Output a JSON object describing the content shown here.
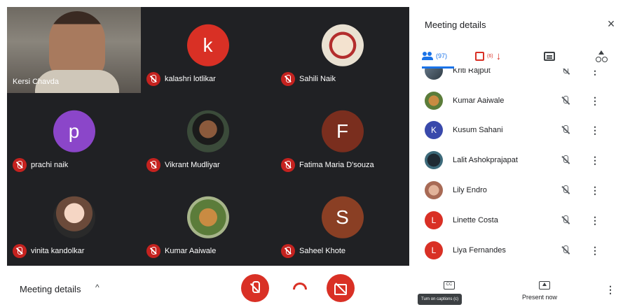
{
  "grid": {
    "tiles": [
      {
        "name": "Kersi Chavda",
        "type": "camera"
      },
      {
        "name": "kalashri lotlikar",
        "initial": "k",
        "color": "#d93025"
      },
      {
        "name": "Sahili Naik",
        "type": "food"
      },
      {
        "name": "prachi naik",
        "initial": "p",
        "color": "#8b46c9"
      },
      {
        "name": "Vikrant Mudliyar",
        "type": "man"
      },
      {
        "name": "Fatima Maria D'souza",
        "initial": "F",
        "color": "#7a2e1e"
      },
      {
        "name": "vinita kandolkar",
        "type": "woman"
      },
      {
        "name": "Kumar Aaiwale",
        "type": "garden"
      },
      {
        "name": "Saheel Khote",
        "initial": "S",
        "color": "#8a3f24"
      }
    ]
  },
  "panel": {
    "title": "Meeting details",
    "close_icon": "×",
    "tabs": {
      "people_count": "(97)",
      "tasks_count": "(6)",
      "download_arrow": "↓"
    },
    "participants": [
      {
        "name": "Kriti Rajput",
        "type": "photo"
      },
      {
        "name": "Kumar Aaiwale",
        "type": "photo"
      },
      {
        "name": "Kusum Sahani",
        "initial": "K",
        "color": "#3949ab"
      },
      {
        "name": "Lalit Ashokprajapat",
        "type": "photo"
      },
      {
        "name": "Lily Endro",
        "type": "photo"
      },
      {
        "name": "Linette Costa",
        "initial": "L",
        "color": "#d93025"
      },
      {
        "name": "Liya Fernandes",
        "initial": "L",
        "color": "#d93025"
      }
    ],
    "more_icon": "⋮"
  },
  "bottombar": {
    "meeting_details_label": "Meeting details",
    "chevron": "^",
    "cc_label": "CC",
    "captions_tooltip": "Turn on captions (c)",
    "present_label": "Present now",
    "more_icon": "⋮"
  }
}
